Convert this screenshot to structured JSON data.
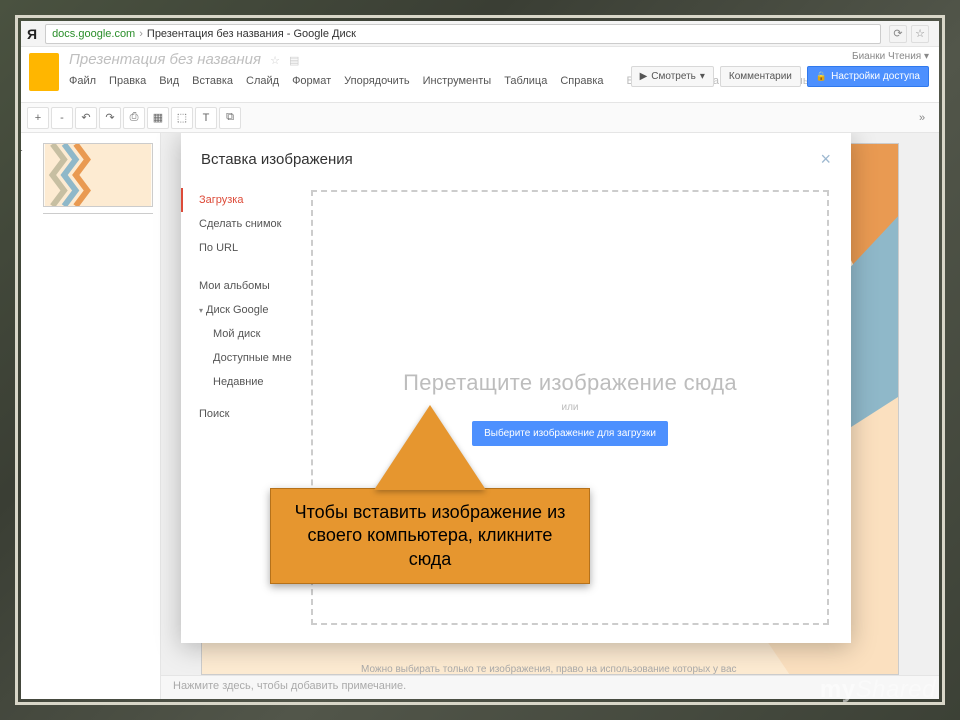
{
  "browser": {
    "search_letter": "Я",
    "url_domain": "docs.google.com",
    "url_sep": "›",
    "url_title": "Презентация без названия - Google Диск",
    "reload_icon": "⟳",
    "star_icon": "☆"
  },
  "doc": {
    "title": "Презентация без названия",
    "star": "☆",
    "folder": "▤",
    "menu": [
      "Файл",
      "Правка",
      "Вид",
      "Вставка",
      "Слайд",
      "Формат",
      "Упорядочить",
      "Инструменты",
      "Таблица",
      "Справка"
    ],
    "saved": "Все изменения на Диске сохранены",
    "user": "Бианки Чтения ▾",
    "btn_view": "Смотреть",
    "btn_view_caret": "▾",
    "btn_comments": "Комментарии",
    "btn_share": "Настройки доступа",
    "lock": "🔒"
  },
  "toolbar": {
    "items": [
      "+",
      "-",
      "↶",
      "↷",
      "⎙",
      "▦",
      "⬚",
      "T",
      "⧉"
    ],
    "collapse": "»"
  },
  "thumb": {
    "num": "1"
  },
  "modal": {
    "title": "Вставка изображения",
    "close": "×",
    "side": {
      "upload": "Загрузка",
      "snapshot": "Сделать снимок",
      "by_url": "По URL",
      "albums": "Мои альбомы",
      "drive": "Диск Google",
      "mydisk": "Мой диск",
      "shared": "Доступные мне",
      "recent": "Недавние",
      "search": "Поиск"
    },
    "drop_big": "Перетащите изображение сюда",
    "drop_or": "или",
    "drop_btn": "Выберите изображение для загрузки"
  },
  "hint_below": "Можно выбирать только те изображения, право на использование которых у вас",
  "notes": "Нажмите здесь, чтобы добавить примечание.",
  "callout": "Чтобы вставить изображение из своего компьютера, кликните сюда",
  "watermark1": "my",
  "watermark2": "Shared"
}
